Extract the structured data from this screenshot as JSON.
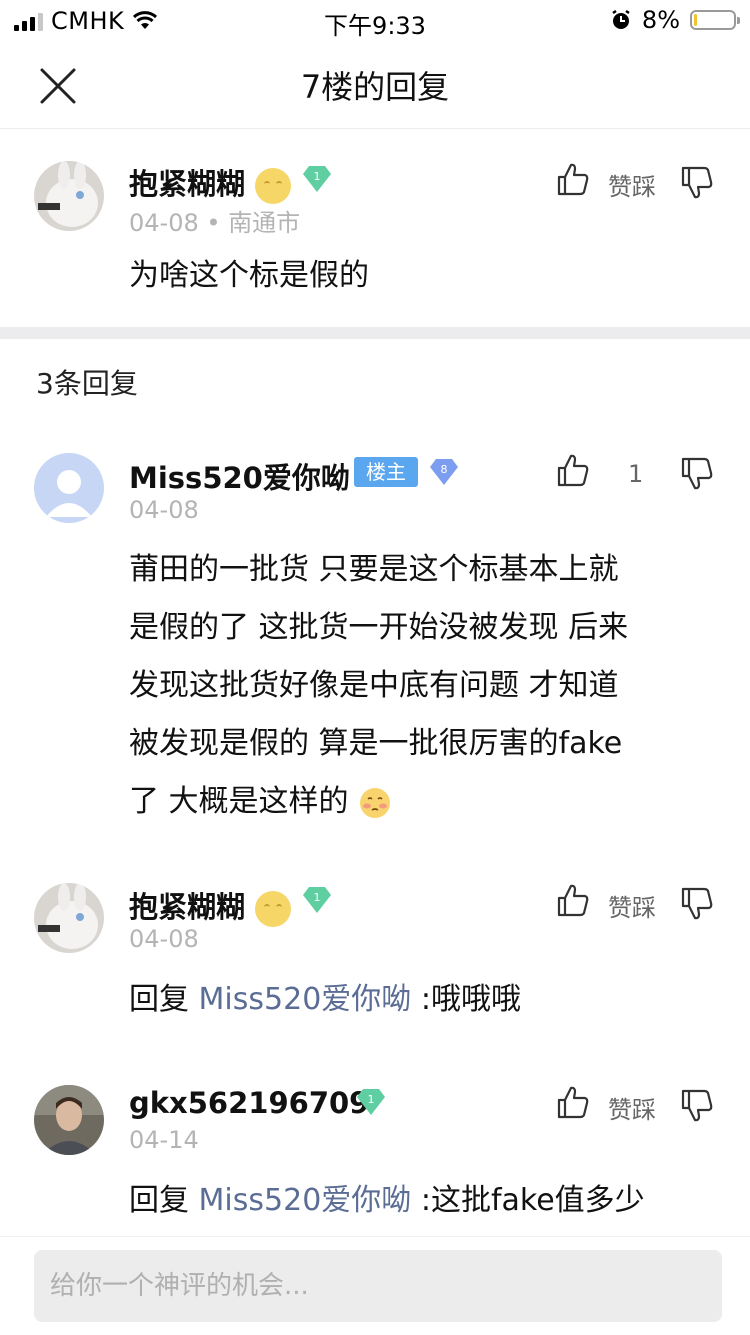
{
  "status_bar": {
    "carrier": "CMHK",
    "time": "下午9:33",
    "battery_percent": "8%",
    "battery_level": 0.08,
    "icons": [
      "signal-icon",
      "wifi-icon",
      "alarm-icon",
      "battery-icon"
    ]
  },
  "nav": {
    "title": "7楼的回复",
    "close_icon": "close-icon"
  },
  "main_comment": {
    "username": "抱紧糊糊",
    "user_emoji": "moon-face",
    "level": "1",
    "date": "04-08",
    "location": "南通市",
    "text": "为啥这个标是假的",
    "like_label": "赞踩"
  },
  "replies_header": "3条回复",
  "replies": [
    {
      "username": "Miss520爱你呦",
      "badge": "楼主",
      "level": "8",
      "date": "04-08",
      "like_count": "1",
      "lines": [
        "莆田的一批货 只要是这个标基本上就",
        "是假的了 这批货一开始没被发现 后来",
        "发现这批货好像是中底有问题 才知道",
        "被发现是假的 算是一批很厉害的fake",
        "了 大概是这样的"
      ]
    },
    {
      "username": "抱紧糊糊",
      "level": "1",
      "date": "04-08",
      "like_label": "赞踩",
      "reply_prefix": "回复",
      "reply_to": "Miss520爱你呦",
      "text": ":哦哦哦"
    },
    {
      "username": "gkx562196709",
      "level": "1",
      "date": "04-14",
      "like_label": "赞踩",
      "reply_prefix": "回复",
      "reply_to": "Miss520爱你呦",
      "text": ":这批fake值多少"
    }
  ],
  "input": {
    "placeholder": "给你一个神评的机会..."
  },
  "colors": {
    "reply_link": "#5b6d94",
    "host_badge": "#5aa7f0",
    "gem_green": "#5fcfa2",
    "gem_blue": "#7d9ef0",
    "divider": "#ececee"
  }
}
